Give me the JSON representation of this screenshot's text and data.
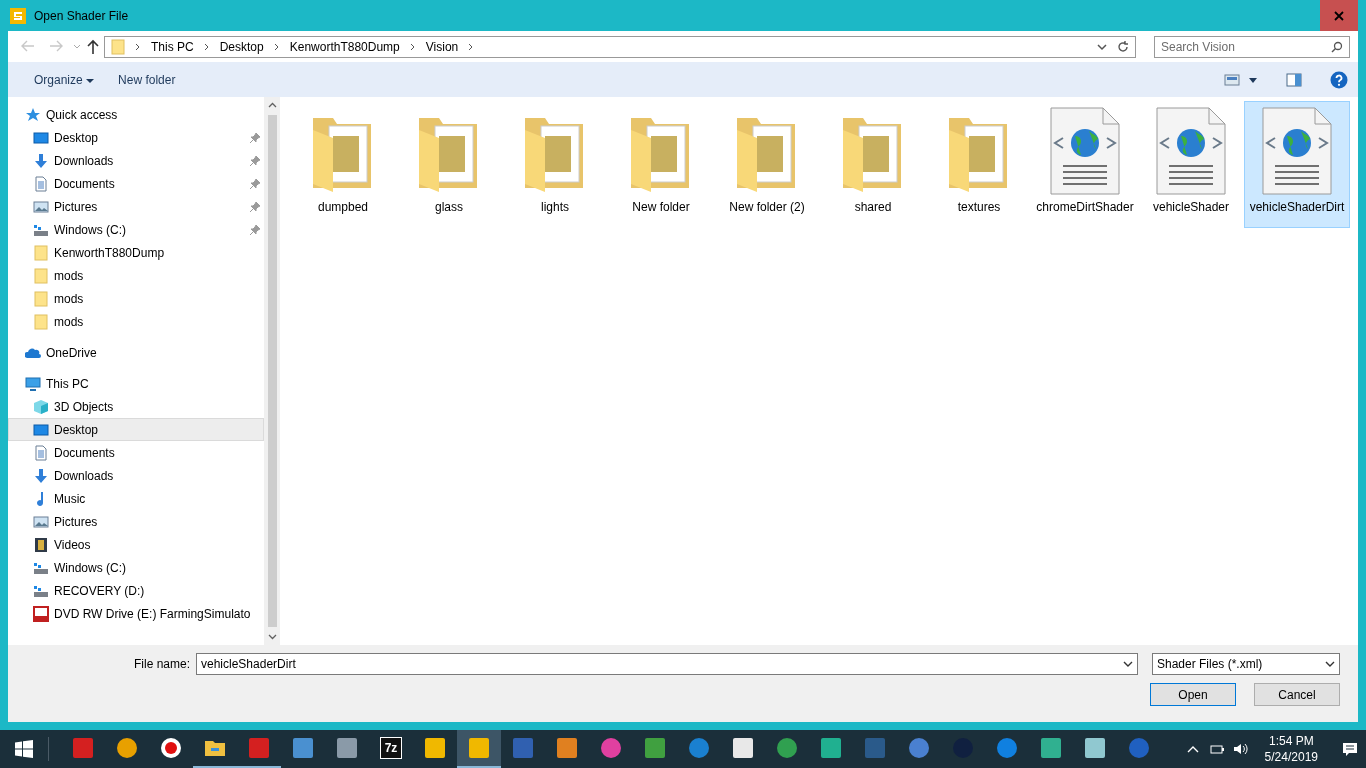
{
  "window": {
    "title": "Open Shader File"
  },
  "navigation": {
    "back_disabled": true,
    "forward_disabled": true
  },
  "breadcrumb": [
    "This PC",
    "Desktop",
    "KenworthT880Dump",
    "Vision"
  ],
  "search": {
    "placeholder": "Search Vision"
  },
  "toolbar": {
    "organize": "Organize",
    "new_folder": "New folder"
  },
  "sidebar": {
    "groups": [
      {
        "label": "Quick access",
        "kind": "quick",
        "items": [
          {
            "label": "Desktop",
            "kind": "desktop",
            "pinned": true,
            "selected": false
          },
          {
            "label": "Downloads",
            "kind": "downloads",
            "pinned": true,
            "selected": false
          },
          {
            "label": "Documents",
            "kind": "documents",
            "pinned": true,
            "selected": false
          },
          {
            "label": "Pictures",
            "kind": "pictures",
            "pinned": true,
            "selected": false
          },
          {
            "label": "Windows (C:)",
            "kind": "drive",
            "pinned": true,
            "selected": false
          },
          {
            "label": "KenworthT880Dump",
            "kind": "folder",
            "pinned": false,
            "selected": false
          },
          {
            "label": "mods",
            "kind": "folder",
            "pinned": false,
            "selected": false
          },
          {
            "label": "mods",
            "kind": "folder",
            "pinned": false,
            "selected": false
          },
          {
            "label": "mods",
            "kind": "folder",
            "pinned": false,
            "selected": false
          }
        ]
      },
      {
        "label": "OneDrive",
        "kind": "cloud"
      },
      {
        "label": "This PC",
        "kind": "pc",
        "items": [
          {
            "label": "3D Objects",
            "kind": "cube",
            "pinned": false,
            "selected": false
          },
          {
            "label": "Desktop",
            "kind": "desktop",
            "pinned": false,
            "selected": true
          },
          {
            "label": "Documents",
            "kind": "documents",
            "pinned": false,
            "selected": false
          },
          {
            "label": "Downloads",
            "kind": "downloads",
            "pinned": false,
            "selected": false
          },
          {
            "label": "Music",
            "kind": "music",
            "pinned": false,
            "selected": false
          },
          {
            "label": "Pictures",
            "kind": "pictures",
            "pinned": false,
            "selected": false
          },
          {
            "label": "Videos",
            "kind": "videos",
            "pinned": false,
            "selected": false
          },
          {
            "label": "Windows (C:)",
            "kind": "drive",
            "pinned": false,
            "selected": false
          },
          {
            "label": "RECOVERY (D:)",
            "kind": "drive",
            "pinned": false,
            "selected": false
          },
          {
            "label": "DVD RW Drive (E:) FarmingSimulato",
            "kind": "dvd",
            "pinned": false,
            "selected": false
          }
        ]
      }
    ]
  },
  "files": [
    {
      "name": "dumpbed",
      "kind": "folder",
      "selected": false
    },
    {
      "name": "glass",
      "kind": "folder",
      "selected": false
    },
    {
      "name": "lights",
      "kind": "folder",
      "selected": false
    },
    {
      "name": "New folder",
      "kind": "folder",
      "selected": false
    },
    {
      "name": "New folder (2)",
      "kind": "folder",
      "selected": false
    },
    {
      "name": "shared",
      "kind": "folder",
      "selected": false
    },
    {
      "name": "textures",
      "kind": "folder",
      "selected": false
    },
    {
      "name": "chromeDirtShader",
      "kind": "xml",
      "selected": false
    },
    {
      "name": "vehicleShader",
      "kind": "xml",
      "selected": false
    },
    {
      "name": "vehicleShaderDirt",
      "kind": "xml",
      "selected": true
    }
  ],
  "file_name": {
    "label": "File name:",
    "value": "vehicleShaderDirt"
  },
  "file_type": {
    "value": "Shader Files (*.xml)"
  },
  "buttons": [
    {
      "label": "Open",
      "kind": "primary"
    },
    {
      "label": "Cancel",
      "kind": "normal"
    }
  ],
  "taskbar": {
    "apps": [
      {
        "kind": "tile",
        "color": "#d42020",
        "running": false,
        "active": false
      },
      {
        "kind": "circle",
        "color": "#e8a000",
        "running": false,
        "active": false
      },
      {
        "kind": "record",
        "color": "#e01010",
        "running": false,
        "active": false
      },
      {
        "kind": "folder",
        "color": "#f0c040",
        "running": true,
        "active": false
      },
      {
        "kind": "tile",
        "color": "#d42020",
        "running": true,
        "active": false
      },
      {
        "kind": "tile",
        "color": "#4a90d0",
        "running": false,
        "active": false
      },
      {
        "kind": "tile",
        "color": "#8a9aa8",
        "running": false,
        "active": false
      },
      {
        "kind": "text",
        "label": "7z",
        "color": "#111111",
        "running": false,
        "active": false
      },
      {
        "kind": "tile",
        "color": "#f0b800",
        "running": false,
        "active": false
      },
      {
        "kind": "tile",
        "color": "#f0b800",
        "running": true,
        "active": true
      },
      {
        "kind": "tile",
        "color": "#3060b0",
        "running": false,
        "active": false
      },
      {
        "kind": "tile",
        "color": "#e08020",
        "running": false,
        "active": false
      },
      {
        "kind": "circle",
        "color": "#e040a0",
        "running": false,
        "active": false
      },
      {
        "kind": "tile",
        "color": "#40a040",
        "running": false,
        "active": false
      },
      {
        "kind": "circle",
        "color": "#1a80d0",
        "running": false,
        "active": false
      },
      {
        "kind": "tile",
        "color": "#e8e8e8",
        "running": false,
        "active": false
      },
      {
        "kind": "circle",
        "color": "#30a050",
        "running": false,
        "active": false
      },
      {
        "kind": "tile",
        "color": "#20b090",
        "running": false,
        "active": false
      },
      {
        "kind": "tile",
        "color": "#2a5a8a",
        "running": false,
        "active": false
      },
      {
        "kind": "circle",
        "color": "#4a80d0",
        "running": false,
        "active": false
      },
      {
        "kind": "circle",
        "color": "#102040",
        "running": false,
        "active": false
      },
      {
        "kind": "circle",
        "color": "#1080e0",
        "running": false,
        "active": false
      },
      {
        "kind": "tile",
        "color": "#30b090",
        "running": false,
        "active": false
      },
      {
        "kind": "tile",
        "color": "#90c8d0",
        "running": false,
        "active": false
      },
      {
        "kind": "circle",
        "color": "#2060c0",
        "running": false,
        "active": false
      }
    ],
    "time": "1:54 PM",
    "date": "5/24/2019"
  }
}
